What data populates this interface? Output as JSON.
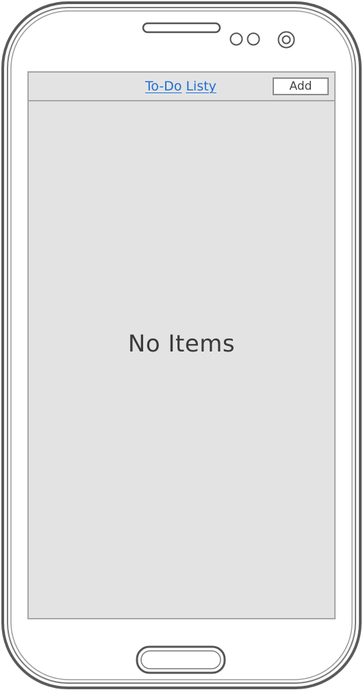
{
  "app": {
    "title_word1": "To-Do",
    "title_word2": "Listy",
    "add_label": "Add"
  },
  "main": {
    "empty_message": "No Items"
  },
  "colors": {
    "title_link": "#1d6fd6",
    "screen_bg": "#e3e3e3",
    "frame": "#666666"
  },
  "icons": [
    "speaker-slot-icon",
    "sensor-icon",
    "camera-icon",
    "home-button-icon"
  ]
}
